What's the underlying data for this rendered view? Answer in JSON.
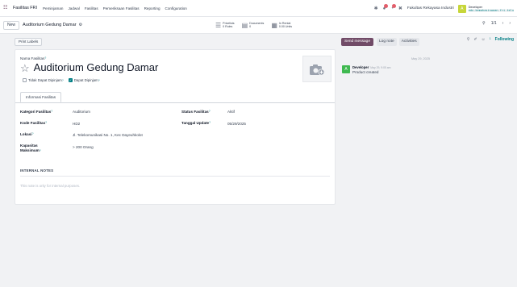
{
  "navbar": {
    "brand": "Fasilitas FRI",
    "menu": [
      "Peminjaman",
      "Jadwal",
      "Fasilitas",
      "Pemeriksaan Fasilitas",
      "Reporting",
      "Configuration"
    ],
    "company": "Fakultas Rekayasa Industri",
    "avatar_letter": "A",
    "user_name": "Developer",
    "user_db": "edu-kemahasiswaan-fri-telu"
  },
  "control": {
    "new_label": "New",
    "breadcrumb_title": "Auditorium Gedung Damar",
    "smart_buttons": [
      {
        "line1": "Pricelists",
        "line2": "0 Rules"
      },
      {
        "line1": "Documents",
        "line2": "0"
      },
      {
        "line1": "In Rental",
        "line2": "0.00 Units"
      }
    ],
    "pager": "1/1"
  },
  "form": {
    "print_label": "Print Labels",
    "name_label": "Nama Fasilitas",
    "name_value": "Auditorium Gedung Damar",
    "check_tidak_label": "Tidak Dapat Dipinjam",
    "check_dapat_label": "Dapat Dipinjam",
    "check_tidak_value": false,
    "check_dapat_value": true,
    "tab_label": "Informasi Fasilitas",
    "fields": {
      "kategori": {
        "label": "Kategori Fasilitas",
        "value": "Auditorium"
      },
      "kode": {
        "label": "Kode Fasilitas",
        "value": "HD2"
      },
      "lokasi": {
        "label": "Lokasi",
        "value": "Jl. Telekomunikasi No. 1, Kec Dayeuhkolot"
      },
      "kapasitas": {
        "label_1": "Kapasitas",
        "label_2": "Maksimum",
        "value": "> 200 Orang"
      },
      "status": {
        "label": "Status Fasilitas",
        "value": "Aktif"
      },
      "tanggal": {
        "label": "Tanggal Update",
        "value": "05/29/2025"
      }
    },
    "notes_title": "INTERNAL NOTES",
    "notes_placeholder": "This note is only for internal purposes."
  },
  "chatter": {
    "send_label": "Send message",
    "log_label": "Log note",
    "activities_label": "Activities",
    "followers_count": "1",
    "following_label": "Following",
    "date_separator": "May 29, 2025",
    "message": {
      "avatar_letter": "A",
      "author": "Developer",
      "time": "May 29, 9:05 am",
      "text": "Product created"
    }
  },
  "colors": {
    "brand": "#714b67",
    "accent": "#017e84",
    "avatar_user": "#c7d63a",
    "avatar_msg": "#3fb950"
  }
}
